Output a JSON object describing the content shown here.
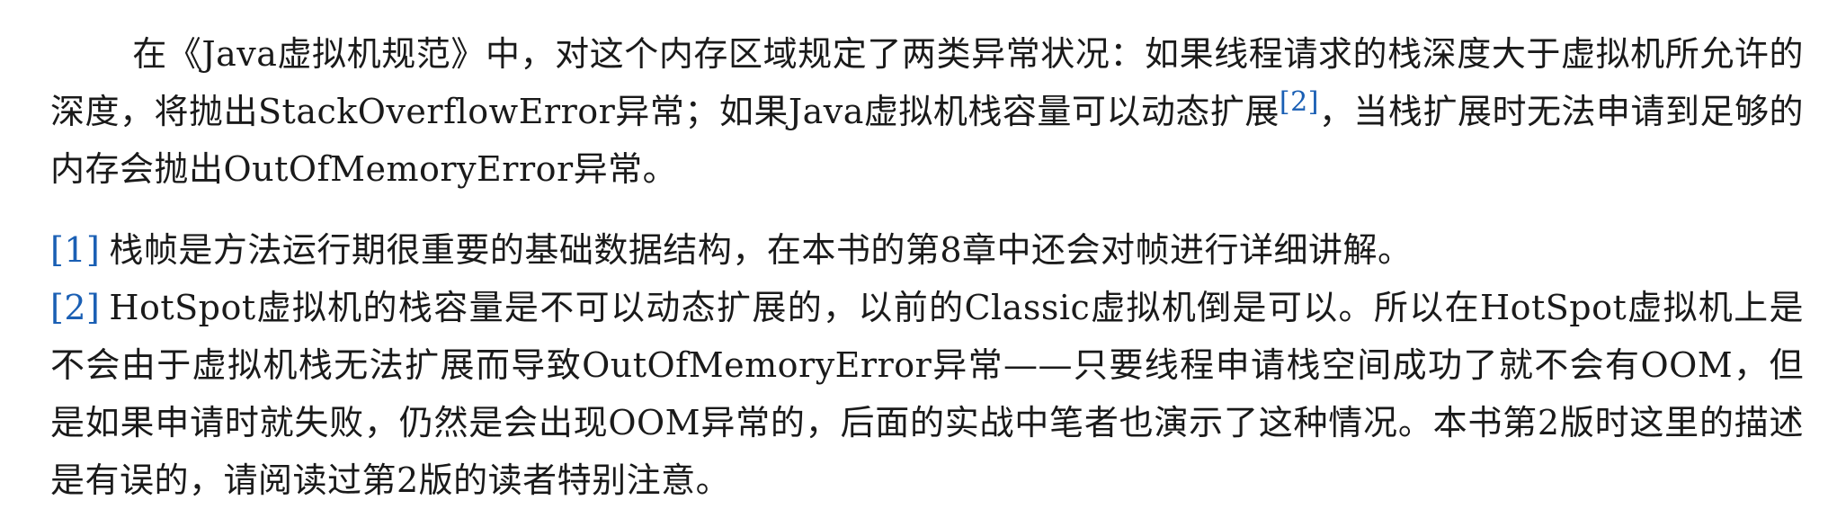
{
  "main_paragraph": {
    "part1": "在《Java虚拟机规范》中，对这个内存区域规定了两类异常状况：如果线程请求的栈深度大于虚拟机所允许的深度，将抛出StackOverflowError异常；如果Java虚拟机栈容量可以动态扩展",
    "ref": "[2]",
    "part2": "，当栈扩展时无法申请到足够的内存会抛出OutOfMemoryError异常。"
  },
  "footnotes": [
    {
      "marker": "[1]",
      "text": "栈帧是方法运行期很重要的基础数据结构，在本书的第8章中还会对帧进行详细讲解。"
    },
    {
      "marker": "[2]",
      "text": "HotSpot虚拟机的栈容量是不可以动态扩展的，以前的Classic虚拟机倒是可以。所以在HotSpot虚拟机上是不会由于虚拟机栈无法扩展而导致OutOfMemoryError异常——只要线程申请栈空间成功了就不会有OOM，但是如果申请时就失败，仍然是会出现OOM异常的，后面的实战中笔者也演示了这种情况。本书第2版时这里的描述是有误的，请阅读过第2版的读者特别注意。"
    }
  ],
  "colors": {
    "link": "#1a5fb4",
    "text": "#1a1a1a"
  }
}
